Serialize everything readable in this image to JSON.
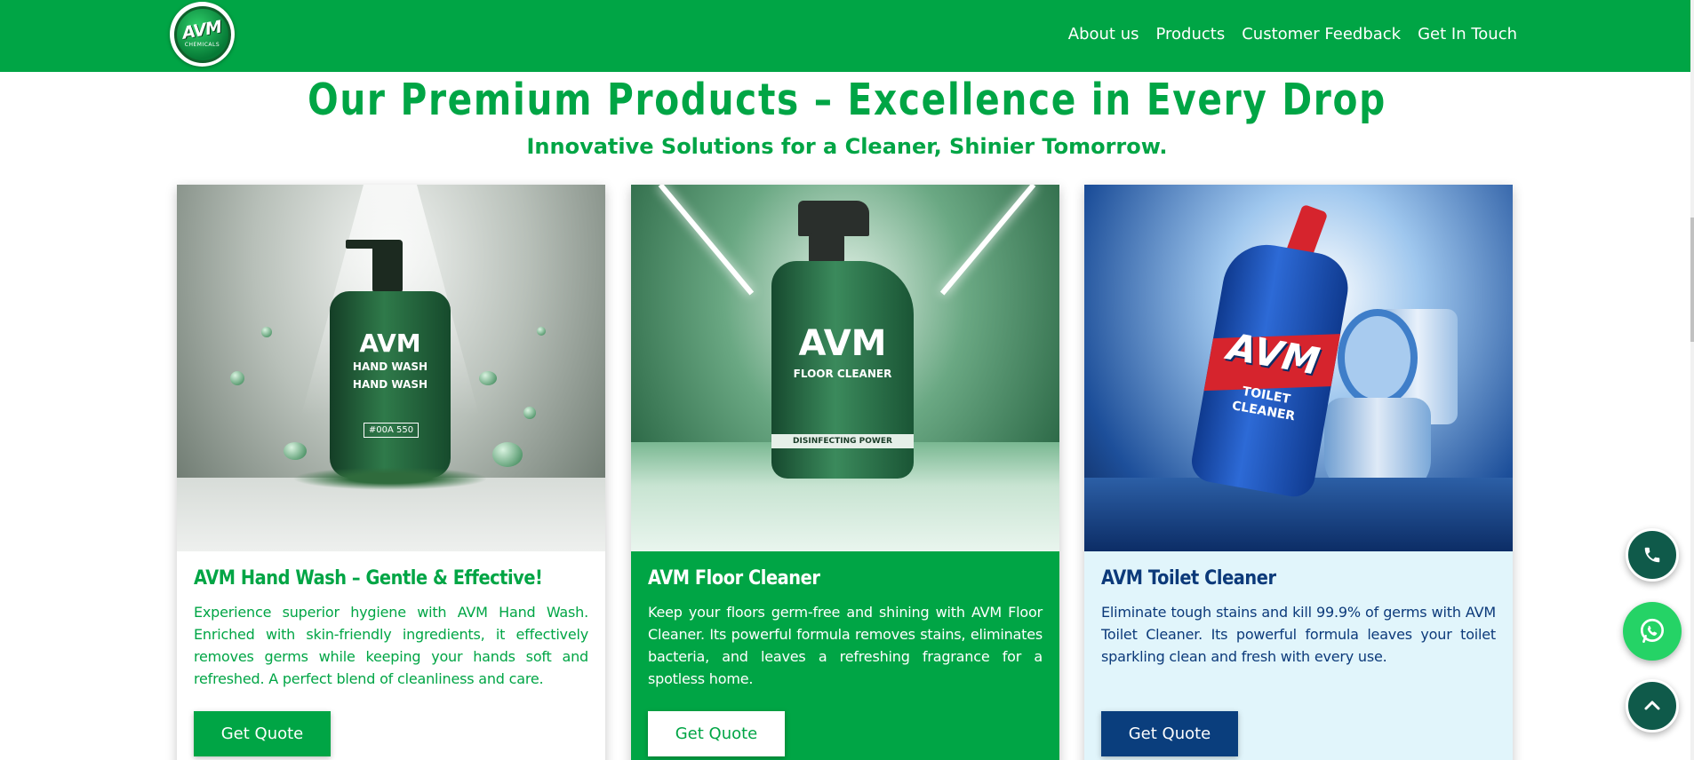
{
  "brand": {
    "logo_text": "AVM",
    "logo_subtext": "CHEMICALS",
    "colors": {
      "primary": "#00a545",
      "navy": "#0a3e7d",
      "light_blue_bg": "#e1f5fb",
      "fab_dark": "#0f5a4a",
      "whatsapp": "#25d366"
    }
  },
  "nav": {
    "items": [
      {
        "label": "About us"
      },
      {
        "label": "Products"
      },
      {
        "label": "Customer Feedback"
      },
      {
        "label": "Get In Touch"
      }
    ]
  },
  "section": {
    "title": "Our Premium Products – Excellence in Every Drop",
    "subtitle": "Innovative Solutions for a Cleaner, Shinier Tomorrow."
  },
  "products": [
    {
      "title": "AVM Hand Wash – Gentle & Effective!",
      "description": "Experience superior hygiene with AVM Hand Wash. Enriched with skin-friendly ingredients, it effectively removes germs while keeping your hands soft and refreshed. A perfect blend of cleanliness and care.",
      "button": "Get Quote",
      "image_label": {
        "brand": "AVM",
        "line1": "HAND WASH",
        "line2": "HAND WASH",
        "code": "#00A 550"
      }
    },
    {
      "title": "AVM Floor Cleaner",
      "description": "Keep your floors germ-free and shining with AVM Floor Cleaner. Its powerful formula removes stains, eliminates bacteria, and leaves a refreshing fragrance for a spotless home.",
      "button": "Get Quote",
      "image_label": {
        "brand": "AVM",
        "line1": "FLOOR CLEANER",
        "line2": "DISINFECTING POWER"
      }
    },
    {
      "title": "AVM Toilet Cleaner",
      "description": "Eliminate tough stains and kill 99.9% of germs with AVM Toilet Cleaner. Its powerful formula leaves your toilet sparkling clean and fresh with every use.",
      "button": "Get Quote",
      "image_label": {
        "brand": "AVM",
        "line1": "TOILET",
        "line2": "CLEANER"
      }
    }
  ],
  "floating_actions": [
    {
      "icon": "phone-icon"
    },
    {
      "icon": "whatsapp-icon"
    },
    {
      "icon": "chevron-up-icon"
    }
  ]
}
